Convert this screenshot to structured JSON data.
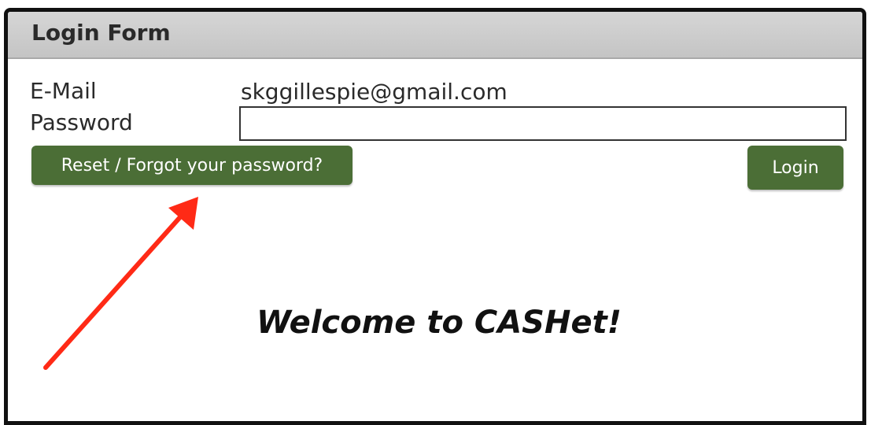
{
  "form": {
    "title": "Login Form",
    "email_label": "E-Mail",
    "email_value": "skggillespie@gmail.com",
    "password_label": "Password",
    "password_value": "",
    "reset_button_label": "Reset / Forgot your password?",
    "login_button_label": "Login"
  },
  "welcome_text": "Welcome to CASHet!",
  "colors": {
    "button_green": "#4b6e36",
    "annotation_arrow": "#ff2a16",
    "header_gray": "#cccccc"
  }
}
